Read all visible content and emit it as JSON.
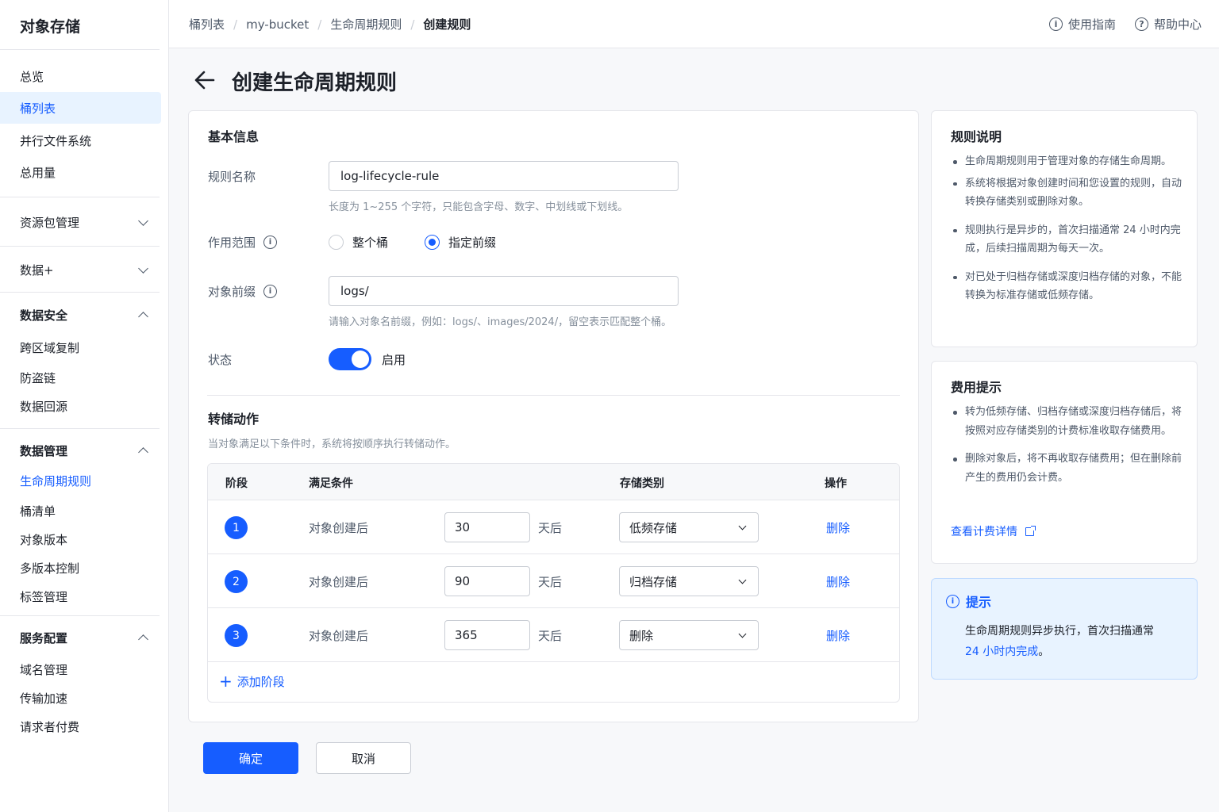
{
  "sidebar": {
    "title": "对象存储",
    "items": {
      "overview": "总览",
      "bucket_list": "桶列表",
      "pfs": "并行文件系统",
      "usage": "总用量"
    },
    "groups": {
      "resource_pack": "资源包管理",
      "data_plus": "数据+",
      "data_security": "数据安全",
      "data_management": "数据管理",
      "service_config": "服务配置"
    },
    "security_items": [
      "跨区域复制",
      "防盗链",
      "数据回源"
    ],
    "management_items": [
      "生命周期规则",
      "桶清单",
      "对象版本",
      "多版本控制",
      "标签管理"
    ],
    "service_items": [
      "域名管理",
      "传输加速",
      "请求者付费"
    ]
  },
  "header": {
    "breadcrumbs": [
      "桶列表",
      "my-bucket",
      "生命周期规则",
      "创建规则"
    ],
    "guide": "使用指南",
    "help": "帮助中心"
  },
  "page": {
    "title": "创建生命周期规则"
  },
  "basic": {
    "section_title": "基本信息",
    "rule_name_label": "规则名称",
    "rule_name_value": "log-lifecycle-rule",
    "rule_name_hint": "长度为 1~255 个字符，只能包含字母、数字、中划线或下划线。",
    "scope_label": "作用范围",
    "scope_options": [
      "整个桶",
      "指定前缀"
    ],
    "scope_selected": "指定前缀",
    "prefix_label": "对象前缀",
    "prefix_value": "logs/",
    "prefix_hint": "请输入对象名前缀，例如：logs/、images/2024/，留空表示匹配整个桶。",
    "status_label": "状态",
    "status_value": "启用"
  },
  "transition": {
    "section_title": "转储动作",
    "desc": "当对象满足以下条件时，系统将按顺序执行转储动作。",
    "columns": [
      "阶段",
      "满足条件",
      "存储类别",
      "操作"
    ],
    "rows": [
      {
        "stage": "1",
        "condition": "对象创建后",
        "days": "30",
        "unit": "天后",
        "storage": "低频存储",
        "action": "删除"
      },
      {
        "stage": "2",
        "condition": "对象创建后",
        "days": "90",
        "unit": "天后",
        "storage": "归档存储",
        "action": "删除"
      },
      {
        "stage": "3",
        "condition": "对象创建后",
        "days": "365",
        "unit": "天后",
        "storage": "删除",
        "action": "删除"
      }
    ],
    "add_stage": "添加阶段"
  },
  "actions": {
    "confirm": "确定",
    "cancel": "取消"
  },
  "rules_card": {
    "title": "规则说明",
    "bullets": [
      "生命周期规则用于管理对象的存储生命周期。",
      "系统将根据对象创建时间和您设置的规则，自动转换存储类别或删除对象。",
      "规则执行是异步的，首次扫描通常 24 小时内完成，后续扫描周期为每天一次。",
      "对已处于归档存储或深度归档存储的对象，不能转换为标准存储或低频存储。"
    ]
  },
  "fee_card": {
    "title": "费用提示",
    "bullets": [
      "转为低频存储、归档存储或深度归档存储后，将按照对应存储类别的计费标准收取存储费用。",
      "删除对象后，将不再收取存储费用；但在删除前产生的费用仍会计费。"
    ],
    "link": "查看计费详情"
  },
  "tip_card": {
    "title": "提示",
    "text_plain": "生命周期规则异步执行，首次扫描通常",
    "text_highlight": "24 小时内完成",
    "text_end": "。"
  },
  "colors": {
    "primary": "#165dff",
    "tip_bg": "#e8f3ff"
  }
}
